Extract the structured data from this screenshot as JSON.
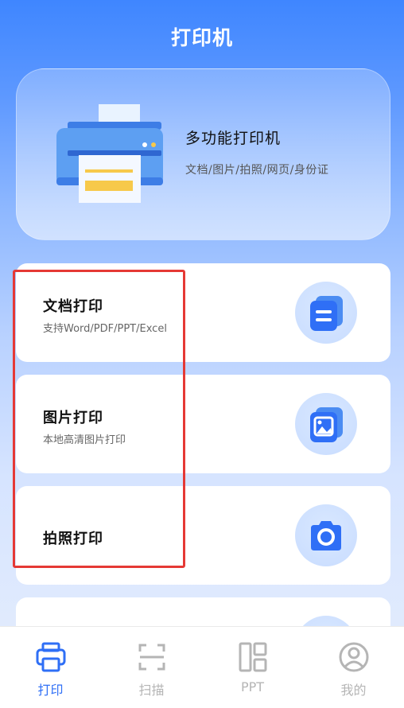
{
  "header": {
    "title": "打印机"
  },
  "hero": {
    "title": "多功能打印机",
    "subtitle": "文档/图片/拍照/网页/身份证"
  },
  "cards": [
    {
      "title": "文档打印",
      "subtitle": "支持Word/PDF/PPT/Excel",
      "icon": "document-icon"
    },
    {
      "title": "图片打印",
      "subtitle": "本地高清图片打印",
      "icon": "image-icon"
    },
    {
      "title": "拍照打印",
      "subtitle": "",
      "icon": "camera-icon"
    }
  ],
  "tabbar": {
    "items": [
      {
        "label": "打印",
        "icon": "printer-icon",
        "active": true
      },
      {
        "label": "扫描",
        "icon": "scan-icon",
        "active": false
      },
      {
        "label": "PPT",
        "icon": "layout-icon",
        "active": false
      },
      {
        "label": "我的",
        "icon": "user-icon",
        "active": false
      }
    ]
  },
  "colors": {
    "accent": "#2f6ff6",
    "highlight": "#e53935",
    "inactive": "#b5b5b5"
  }
}
